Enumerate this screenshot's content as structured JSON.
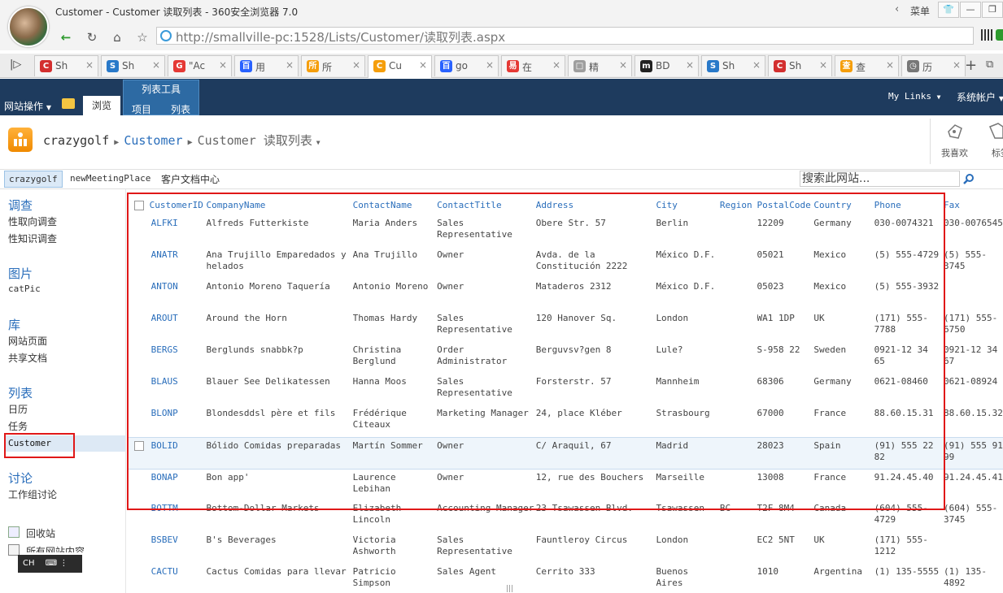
{
  "browser": {
    "window_title": "Customer - Customer 读取列表 - 360安全浏览器 7.0",
    "menu_label": "菜单",
    "url": "http://smallville-pc:1528/Lists/Customer/读取列表.aspx",
    "tabs": [
      {
        "label": "Sh",
        "color": "#d32f2f",
        "glyph": "C"
      },
      {
        "label": "Sh",
        "color": "#2979c9",
        "glyph": "S"
      },
      {
        "label": "\"Ac",
        "color": "#e53935",
        "glyph": "G"
      },
      {
        "label": "用",
        "color": "#2962ff",
        "glyph": "百"
      },
      {
        "label": "所",
        "color": "#f59e0b",
        "glyph": "所"
      },
      {
        "label": "Cu",
        "color": "#f59e0b",
        "glyph": "C"
      },
      {
        "label": "go",
        "color": "#2962ff",
        "glyph": "百"
      },
      {
        "label": "在",
        "color": "#e53935",
        "glyph": "易"
      },
      {
        "label": "精",
        "color": "#9e9e9e",
        "glyph": "□"
      },
      {
        "label": "BD",
        "color": "#222222",
        "glyph": "m"
      },
      {
        "label": "Sh",
        "color": "#2979c9",
        "glyph": "S"
      },
      {
        "label": "Sh",
        "color": "#d32f2f",
        "glyph": "C"
      },
      {
        "label": "查",
        "color": "#f59e0b",
        "glyph": "查"
      },
      {
        "label": "历",
        "color": "#777777",
        "glyph": "◷"
      }
    ]
  },
  "ribbon": {
    "site_actions": "网站操作",
    "browse": "浏览",
    "list_tools": "列表工具",
    "items": "项目",
    "list": "列表",
    "my_links": "My Links",
    "account": "系统帐户"
  },
  "title_area": {
    "site": "crazygolf",
    "list": "Customer",
    "view": "Customer",
    "view_name": "读取列表",
    "like_label": "我喜欢",
    "tag_label": "标签"
  },
  "top_nav": {
    "items": [
      "crazygolf",
      "newMeetingPlace",
      "客户文档中心"
    ],
    "search_placeholder": "搜索此网站..."
  },
  "left_nav": {
    "survey_heading": "调查",
    "survey_items": [
      "性取向调查",
      "性知识调查"
    ],
    "pictures_heading": "图片",
    "pictures_items": [
      "catPic"
    ],
    "libraries_heading": "库",
    "libraries_items": [
      "网站页面",
      "共享文档"
    ],
    "lists_heading": "列表",
    "lists_items": [
      "日历",
      "任务",
      "Customer"
    ],
    "discussions_heading": "讨论",
    "discussions_items": [
      "工作组讨论"
    ],
    "recycle_bin": "回收站",
    "all_content": "所有网站内容"
  },
  "ime": "CH",
  "list": {
    "columns": [
      "CustomerID",
      "CompanyName",
      "ContactName",
      "ContactTitle",
      "Address",
      "City",
      "Region",
      "PostalCode",
      "Country",
      "Phone",
      "Fax"
    ],
    "rows": [
      [
        "ALFKI",
        "Alfreds Futterkiste",
        "Maria Anders",
        "Sales Representative",
        "Obere Str. 57",
        "Berlin",
        "",
        "12209",
        "Germany",
        "030-0074321",
        "030-0076545"
      ],
      [
        "ANATR",
        "Ana Trujillo Emparedados y helados",
        "Ana Trujillo",
        "Owner",
        "Avda. de la Constitución 2222",
        "México D.F.",
        "",
        "05021",
        "Mexico",
        "(5) 555-4729",
        "(5) 555-3745"
      ],
      [
        "ANTON",
        "Antonio Moreno Taquería",
        "Antonio Moreno",
        "Owner",
        "Mataderos 2312",
        "México D.F.",
        "",
        "05023",
        "Mexico",
        "(5) 555-3932",
        ""
      ],
      [
        "AROUT",
        "Around the Horn",
        "Thomas Hardy",
        "Sales Representative",
        "120 Hanover Sq.",
        "London",
        "",
        "WA1 1DP",
        "UK",
        "(171) 555-7788",
        "(171) 555-6750"
      ],
      [
        "BERGS",
        "Berglunds snabbk?p",
        "Christina Berglund",
        "Order Administrator",
        "Berguvsv?gen 8",
        "Lule?",
        "",
        "S-958 22",
        "Sweden",
        "0921-12 34 65",
        "0921-12 34 67"
      ],
      [
        "BLAUS",
        "Blauer See Delikatessen",
        "Hanna Moos",
        "Sales Representative",
        "Forsterstr. 57",
        "Mannheim",
        "",
        "68306",
        "Germany",
        "0621-08460",
        "0621-08924"
      ],
      [
        "BLONP",
        "Blondesddsl père et fils",
        "Frédérique Citeaux",
        "Marketing Manager",
        "24, place Kléber",
        "Strasbourg",
        "",
        "67000",
        "France",
        "88.60.15.31",
        "88.60.15.32"
      ],
      [
        "BOLID",
        "Bólido Comidas preparadas",
        "Martín Sommer",
        "Owner",
        "C/ Araquil, 67",
        "Madrid",
        "",
        "28023",
        "Spain",
        "(91) 555 22 82",
        "(91) 555 91 99"
      ],
      [
        "BONAP",
        "Bon app'",
        "Laurence Lebihan",
        "Owner",
        "12, rue des Bouchers",
        "Marseille",
        "",
        "13008",
        "France",
        "91.24.45.40",
        "91.24.45.41"
      ],
      [
        "BOTTM",
        "Bottom-Dollar Markets",
        "Elizabeth Lincoln",
        "Accounting Manager",
        "23 Tsawassen Blvd.",
        "Tsawassen",
        "BC",
        "T2F 8M4",
        "Canada",
        "(604) 555-4729",
        "(604) 555-3745"
      ],
      [
        "BSBEV",
        "B's Beverages",
        "Victoria Ashworth",
        "Sales Representative",
        "Fauntleroy Circus",
        "London",
        "",
        "EC2 5NT",
        "UK",
        "(171) 555-1212",
        ""
      ],
      [
        "CACTU",
        "Cactus Comidas para llevar",
        "Patricio Simpson",
        "Sales Agent",
        "Cerrito 333",
        "Buenos Aires",
        "",
        "1010",
        "Argentina",
        "(1) 135-5555",
        "(1) 135-4892"
      ]
    ]
  }
}
